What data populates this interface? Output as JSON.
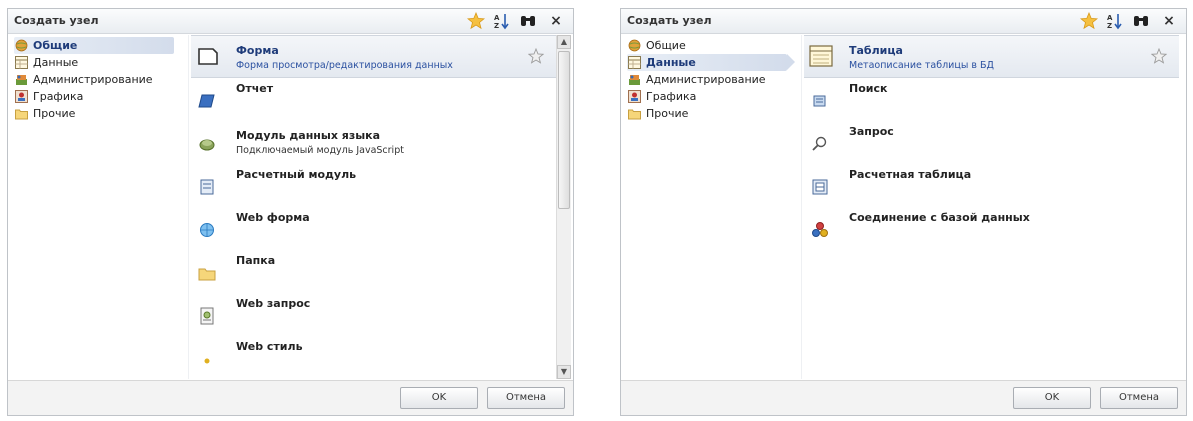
{
  "dialog_left": {
    "title": "Создать узел",
    "categories": [
      {
        "label": "Общие",
        "icon": "globe-icon",
        "selected": true
      },
      {
        "label": "Данные",
        "icon": "table-icon",
        "selected": false
      },
      {
        "label": "Администрирование",
        "icon": "admin-icon",
        "selected": false
      },
      {
        "label": "Графика",
        "icon": "graphics-icon",
        "selected": false
      },
      {
        "label": "Прочие",
        "icon": "folder-icon",
        "selected": false
      }
    ],
    "items": [
      {
        "name": "Форма",
        "desc": "Форма просмотра/редактирования данных",
        "icon": "form-icon",
        "selected": true
      },
      {
        "name": "Отчет",
        "desc": "",
        "icon": "report-icon"
      },
      {
        "name": "Модуль данных языка",
        "desc": "Подключаемый модуль JavaScript",
        "icon": "module-icon"
      },
      {
        "name": "Расчетный модуль",
        "desc": "",
        "icon": "calc-module-icon"
      },
      {
        "name": "Web форма",
        "desc": "",
        "icon": "web-form-icon"
      },
      {
        "name": "Папка",
        "desc": "",
        "icon": "folder-icon"
      },
      {
        "name": "Web запрос",
        "desc": "",
        "icon": "web-query-icon"
      },
      {
        "name": "Web стиль",
        "desc": "",
        "icon": "web-style-icon"
      }
    ],
    "ok_label": "OK",
    "cancel_label": "Отмена"
  },
  "dialog_right": {
    "title": "Создать узел",
    "categories": [
      {
        "label": "Общие",
        "icon": "globe-icon",
        "selected": false
      },
      {
        "label": "Данные",
        "icon": "table-icon",
        "selected": true
      },
      {
        "label": "Администрирование",
        "icon": "admin-icon",
        "selected": false
      },
      {
        "label": "Графика",
        "icon": "graphics-icon",
        "selected": false
      },
      {
        "label": "Прочие",
        "icon": "folder-icon",
        "selected": false
      }
    ],
    "items": [
      {
        "name": "Таблица",
        "desc": "Метаописание таблицы в БД",
        "icon": "table-icon",
        "selected": true
      },
      {
        "name": "Поиск",
        "desc": "",
        "icon": "search-icon"
      },
      {
        "name": "Запрос",
        "desc": "",
        "icon": "query-icon"
      },
      {
        "name": "Расчетная таблица",
        "desc": "",
        "icon": "calc-table-icon"
      },
      {
        "name": "Соединение с базой данных",
        "desc": "",
        "icon": "db-connection-icon"
      }
    ],
    "ok_label": "OK",
    "cancel_label": "Отмена"
  },
  "colors": {
    "selection_text": "#1f3c7a",
    "selection_desc": "#2a50a0",
    "favorite_star": "#f2b530"
  }
}
